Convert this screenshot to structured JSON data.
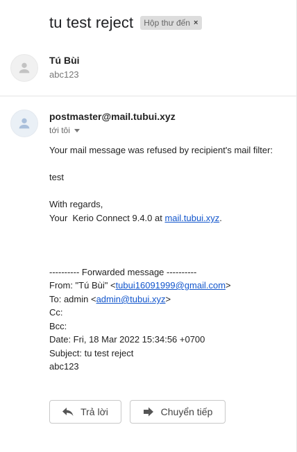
{
  "thread": {
    "subject": "tu test reject",
    "label": "Hộp thư đến",
    "label_remove": "×"
  },
  "message1": {
    "sender": "Tú Bùi",
    "snippet": "abc123",
    "avatar_icon": "person-icon"
  },
  "message2": {
    "sender": "postmaster@mail.tubui.xyz",
    "to": "tới tôi",
    "avatar_icon": "person-icon",
    "line1": "Your mail message was refused by recipient's mail filter:",
    "line2": "test",
    "line3": "With regards,",
    "line4_prefix": "Your  Kerio Connect 9.4.0 at ",
    "line4_link": "mail.tubui.xyz",
    "line4_suffix": ".",
    "fwd_header": "---------- Forwarded message ----------",
    "from_prefix": "From: \"Tú Bùi\" <",
    "from_email": "tubui16091999@gmail.com",
    "from_suffix": ">",
    "to_prefix": "To: admin <",
    "to_email": "admin@tubui.xyz",
    "to_suffix": ">",
    "cc": "Cc:",
    "bcc": "Bcc:",
    "date": "Date: Fri, 18 Mar 2022 15:34:56 +0700",
    "fwd_subject": "Subject: tu test reject",
    "fwd_body": "abc123"
  },
  "actions": {
    "reply": "Trả lời",
    "forward": "Chuyển tiếp"
  },
  "colors": {
    "link": "#1155cc",
    "chip_bg": "#dddddd"
  }
}
